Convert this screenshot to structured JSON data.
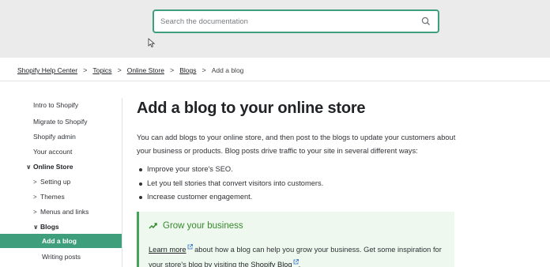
{
  "search": {
    "placeholder": "Search the documentation"
  },
  "breadcrumb": {
    "items": [
      "Shopify Help Center",
      "Topics",
      "Online Store",
      "Blogs"
    ],
    "current": "Add a blog",
    "separator": ">"
  },
  "sidebar": {
    "items": [
      {
        "label": "Intro to Shopify"
      },
      {
        "label": "Migrate to Shopify"
      },
      {
        "label": "Shopify admin"
      },
      {
        "label": "Your account"
      },
      {
        "label": "Online Store",
        "chevron": "∨"
      },
      {
        "label": "Setting up",
        "chevron": ">"
      },
      {
        "label": "Themes",
        "chevron": ">"
      },
      {
        "label": "Menus and links",
        "chevron": ">"
      },
      {
        "label": "Blogs",
        "chevron": "∨"
      },
      {
        "label": "Add a blog"
      },
      {
        "label": "Writing posts"
      }
    ]
  },
  "main": {
    "title": "Add a blog to your online store",
    "intro": "You can add blogs to your online store, and then post to the blogs to update your customers about your business or products. Blog posts drive traffic to your site in several different ways:",
    "bullets": [
      "Improve your store's SEO.",
      "Let you tell stories that convert visitors into customers.",
      "Increase customer engagement."
    ],
    "callout": {
      "title": "Grow your business",
      "link1": "Learn more",
      "text1": " about how a blog can help you grow your business. Get some inspiration for your store's blog by visiting the ",
      "link2": "Shopify Blog",
      "text2": "."
    }
  },
  "colors": {
    "accent": "#3f9f7d",
    "callout_bg": "#eef8ee",
    "callout_title": "#37882e"
  }
}
